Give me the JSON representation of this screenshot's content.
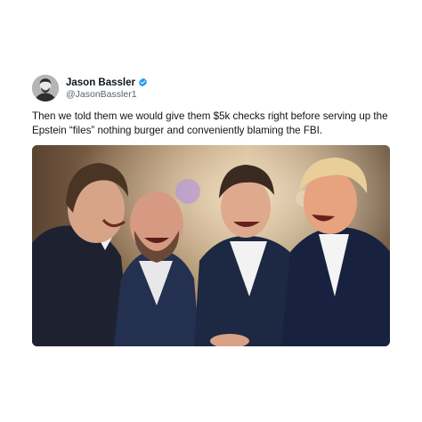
{
  "tweet": {
    "author": {
      "display_name": "Jason Bassler",
      "handle": "@JasonBassler1",
      "verified": true,
      "verified_icon": "verified-badge-icon",
      "verified_color": "#1d9bf0"
    },
    "text": "Then we told them we would give them $5k checks right before serving up the Epstein “files” nothing burger and conveniently blaming the FBI.",
    "media": {
      "type": "photo"
    }
  },
  "colors": {
    "text_primary": "#0f1419",
    "text_secondary": "#536471",
    "background": "#ffffff"
  }
}
